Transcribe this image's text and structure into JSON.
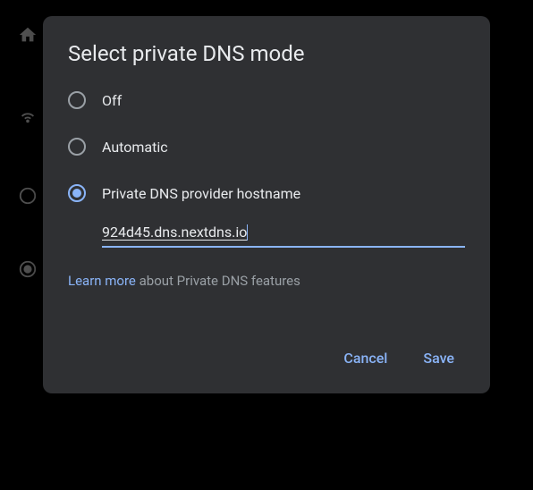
{
  "dialog": {
    "title": "Select private DNS mode",
    "options": [
      {
        "label": "Off",
        "selected": false
      },
      {
        "label": "Automatic",
        "selected": false
      },
      {
        "label": "Private DNS provider hostname",
        "selected": true
      }
    ],
    "hostname_value": "924d45.dns.nextdns.io",
    "learn_more_link": "Learn more",
    "learn_more_text": " about Private DNS features",
    "cancel_label": "Cancel",
    "save_label": "Save"
  }
}
